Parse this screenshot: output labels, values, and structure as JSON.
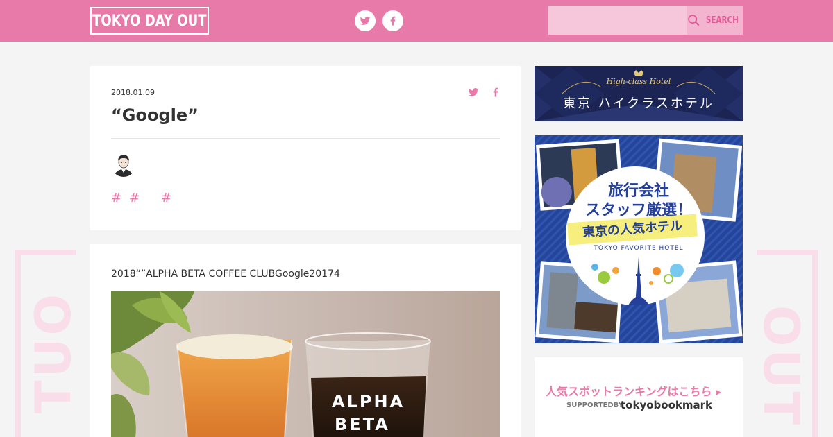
{
  "header": {
    "logo_text": "TOKYO DAY OUT",
    "social": [
      {
        "name": "twitter",
        "icon": "twitter-icon"
      },
      {
        "name": "facebook",
        "icon": "facebook-icon"
      }
    ],
    "search_placeholder": "",
    "search_label": "SEARCH",
    "colors": {
      "brand": "#e87aa9",
      "search_bg": "#f6c6da",
      "search_button": "#f3b4cf"
    }
  },
  "article": {
    "date": "2018.01.09",
    "title": "“Google”",
    "tags": [
      "#",
      "#",
      "#"
    ],
    "body_text": "2018“”ALPHA BETA COFFEE CLUBGoogle20174"
  },
  "photo": {
    "glass_text_1": "ALPHA",
    "glass_text_2": "BETA"
  },
  "background": {
    "left_letters": "TUO",
    "right_letters": "OUT"
  },
  "sidebar": {
    "ad_hotel": {
      "subtitle": "High-class Hotel",
      "title": "東京 ハイクラスホテル"
    },
    "ad_travel": {
      "line1": "旅行会社",
      "line2": "スタッフ厳選！",
      "line3": "東京の人気ホテル",
      "line4": "TOKYO FAVORITE HOTEL"
    },
    "ad_ranking": {
      "headline": "人気スポットランキングはこちら ▸",
      "supported_by": "SUPPORTEDBY",
      "brand": "tokyobookmark"
    }
  }
}
